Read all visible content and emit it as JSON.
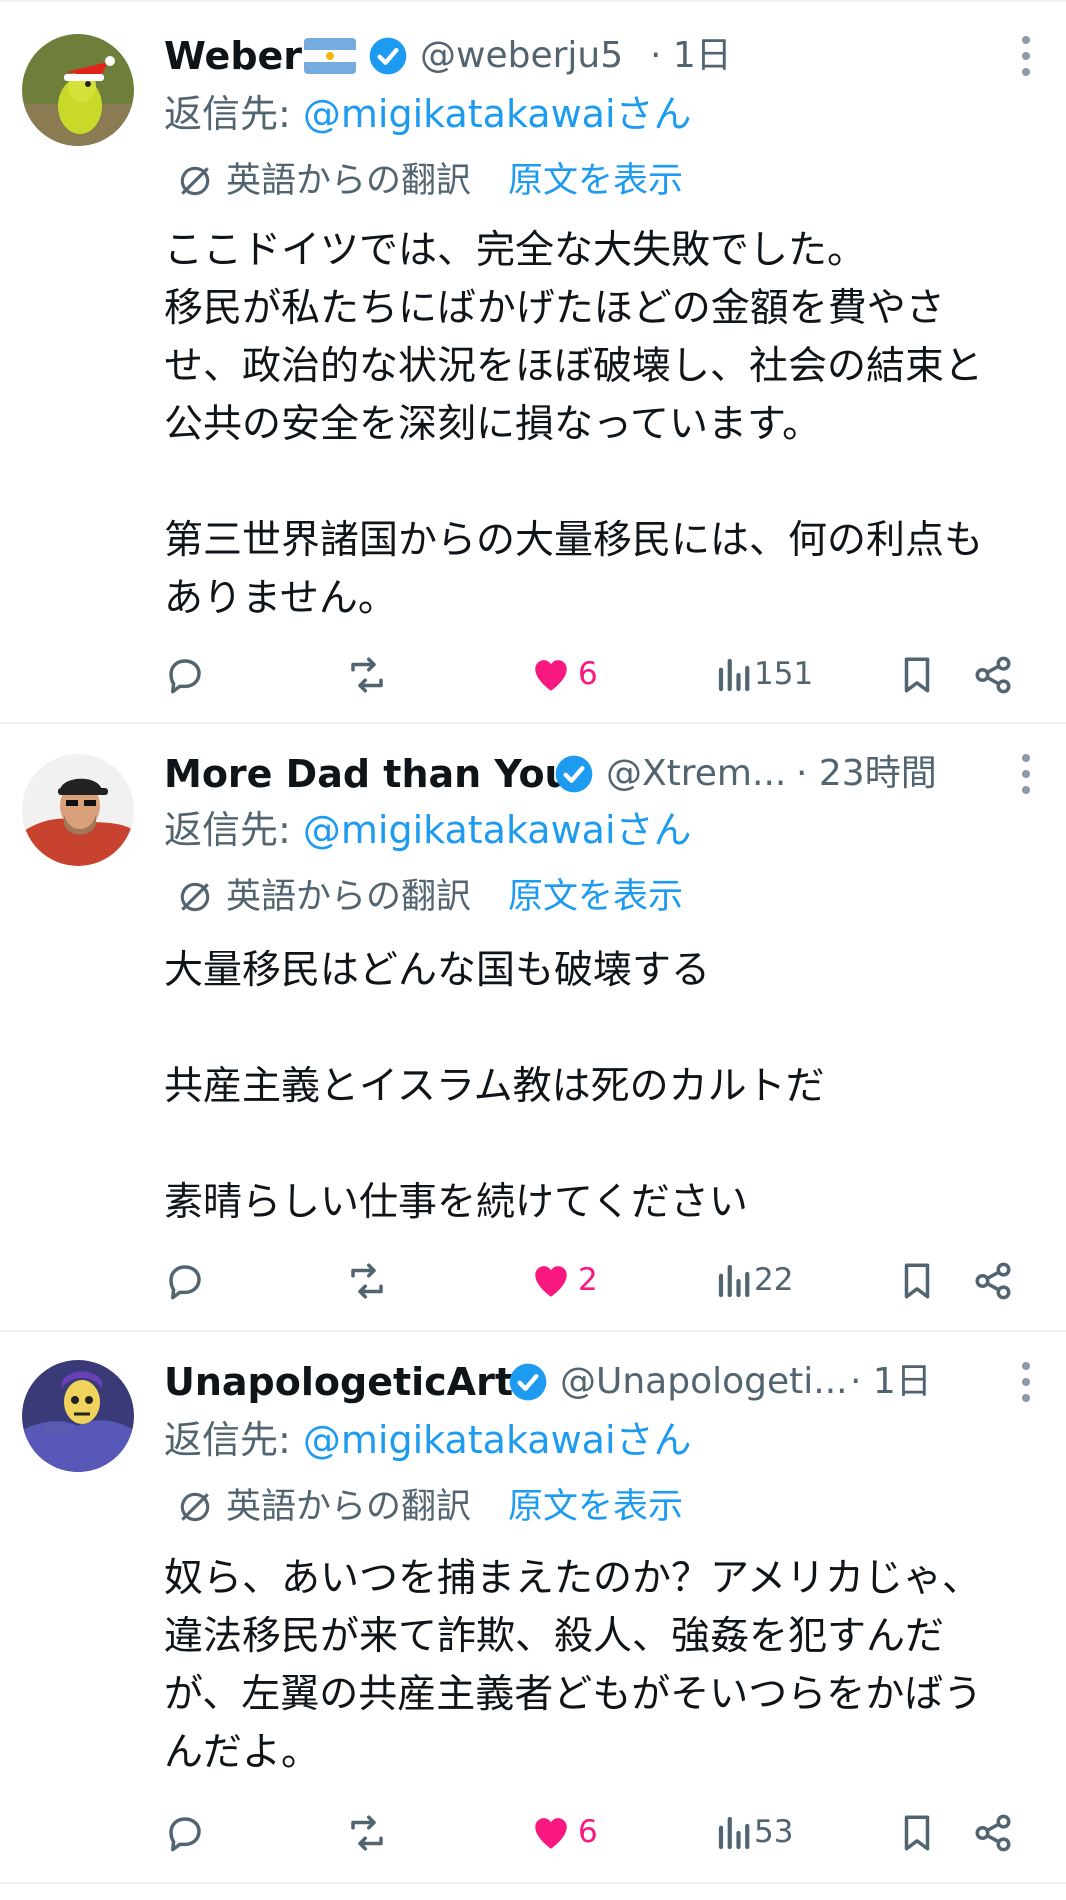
{
  "colors": {
    "text": "#0f1419",
    "secondary": "#536471",
    "link": "#1d9bf0",
    "like": "#f91880",
    "divider": "#eff3f4"
  },
  "translate_label": "英語からの翻訳",
  "show_original_label": "原文を表示",
  "replies": [
    {
      "name": "Weber",
      "has_flag": true,
      "handle": "@weberju5",
      "time": "· 1日",
      "reply_to_prefix": "返信先: ",
      "reply_to": "@migikatakawaiさん",
      "text": "ここドイツでは、完全な大失敗でした。\n移民が私たちにばかげたほどの金額を費やさせ、政治的な状況をほぼ破壊し、社会の結束と公共の安全を深刻に損なっています。\n\n第三世界諸国からの大量移民には、何の利点もありません。",
      "likes": "6",
      "views": "151",
      "avatar": "green-bird-santa-hat"
    },
    {
      "name": "More Dad than You",
      "has_flag": false,
      "handle": "@Xtrem...",
      "time": "· 23時間",
      "reply_to_prefix": "返信先: ",
      "reply_to": "@migikatakawaiさん",
      "text": "大量移民はどんな国も破壊する\n\n共産主義とイスラム教は死のカルトだ\n\n素晴らしい仕事を続けてください",
      "likes": "2",
      "views": "22",
      "avatar": "man-with-cap"
    },
    {
      "name": "UnapologeticArt",
      "has_flag": false,
      "handle": "@Unapologeti...",
      "time": "· 1日",
      "reply_to_prefix": "返信先: ",
      "reply_to": "@migikatakawaiさん",
      "text": "奴ら、あいつを捕まえたのか？アメリカじゃ、違法移民が来て詐欺、殺人、強姦を犯すんだが、左翼の共産主義者どもがそいつらをかばうんだよ。",
      "likes": "6",
      "views": "53",
      "avatar": "skeleton-character"
    }
  ]
}
